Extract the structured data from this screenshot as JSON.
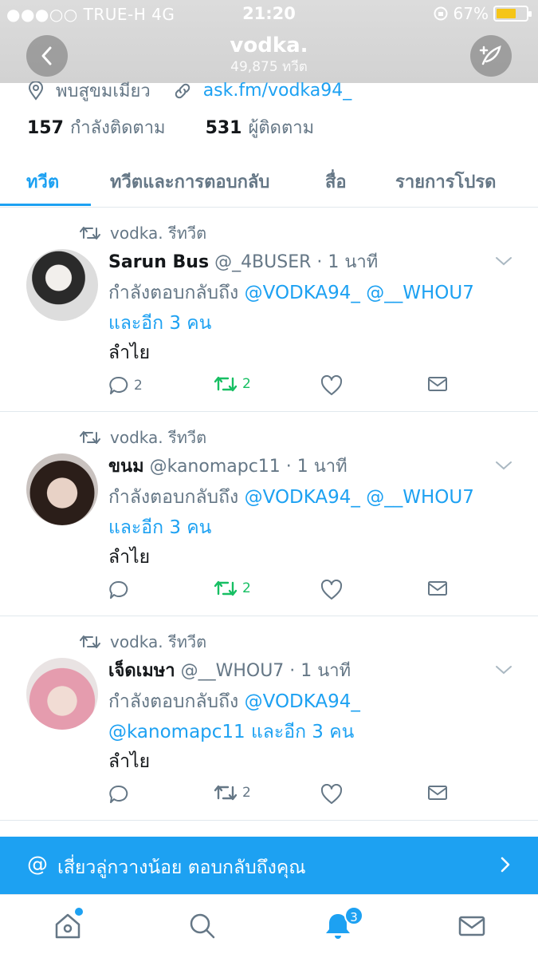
{
  "status_bar": {
    "carrier": "●●●○○ TRUE-H  4G",
    "time": "21:20",
    "battery": "67%",
    "battery_level": 0.67
  },
  "header": {
    "title": "vodka.",
    "subtitle": "49,875 ทวีต"
  },
  "profile": {
    "location": "พบสูขมเมียว",
    "link": "ask.fm/vodka94_",
    "following_count": "157",
    "following_label": "กำลังติดตาม",
    "followers_count": "531",
    "followers_label": "ผู้ติดตาม"
  },
  "tabs": [
    "ทวีต",
    "ทวีตและการตอบกลับ",
    "สื่อ",
    "รายการโปรด"
  ],
  "tweets": [
    {
      "retweet_label": "vodka. รีทวีต",
      "name": "Sarun Bus",
      "handle": "@_4BUSER · 1 นาที",
      "reply_prefix": "กำลังตอบกลับถึง",
      "reply_mentions_1": "@VODKA94_ @__WHOU7",
      "reply_suffix": "และอีก 3 คน",
      "text": "ลำไย",
      "reply_count": "2",
      "retweet_count": "2"
    },
    {
      "retweet_label": "vodka. รีทวีต",
      "name": "ขนม",
      "handle": "@kanomapc11 · 1 นาที",
      "reply_prefix": "กำลังตอบกลับถึง",
      "reply_mentions_1": "@VODKA94_ @__WHOU7",
      "reply_suffix": "และอีก 3 คน",
      "text": "ลำไย",
      "reply_count": "",
      "retweet_count": "2"
    },
    {
      "retweet_label": "vodka. รีทวีต",
      "name": "เจ็ดเมษา",
      "handle": "@__WHOU7 · 1 นาที",
      "reply_prefix": "กำลังตอบกลับถึง",
      "reply_mentions_1": "@VODKA94_",
      "reply_suffix": "@kanomapc11 และอีก 3 คน",
      "text": "ลำไย",
      "reply_count": "",
      "retweet_count": "2"
    }
  ],
  "banner": {
    "at": "@",
    "text": "เสี่ยวลู่กวางน้อย ตอบกลับถึงคุณ"
  },
  "notifications_badge": "3",
  "colors": {
    "accent": "#1da1f2",
    "retweet_green": "#17bf63",
    "muted": "#657786"
  }
}
